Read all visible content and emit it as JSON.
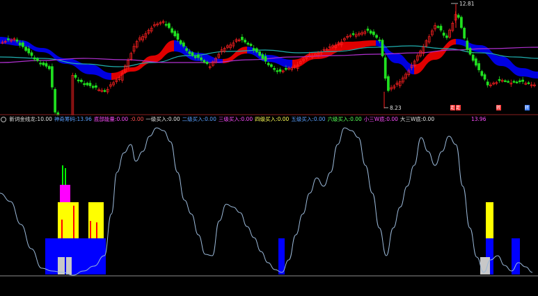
{
  "upper_panel": {
    "high_label": "12.81",
    "low_label": "8.23",
    "right_markers": [
      {
        "text": "走",
        "color": "#ff3b3b"
      },
      {
        "text": "走",
        "color": "#ff3b3b"
      },
      {
        "text": "转",
        "color": "#ff3b3b"
      },
      {
        "text": "转",
        "color": "#3b7bff"
      }
    ]
  },
  "indicator_bar": {
    "prefix_icon": "settings-icon",
    "items": [
      {
        "label": "新词金线龙",
        "value": "10.00",
        "color": "#e0e0e0",
        "sep": ":"
      },
      {
        "label": "神奇筹码",
        "value": "13.96",
        "color": "#5aa0ff",
        "sep": ":"
      },
      {
        "label": "底部能量",
        "value": "0.00",
        "color": "#ff4dff",
        "sep": ":"
      },
      {
        "label": "",
        "value": "0.00",
        "color": "#ff4d4d",
        "sep": ":"
      },
      {
        "label": "一级买入",
        "value": "0.00",
        "color": "#e0e0e0",
        "sep": ":"
      },
      {
        "label": "二级买入",
        "value": "0.00",
        "color": "#5aa0ff",
        "sep": ":"
      },
      {
        "label": "三级买入",
        "value": "0.00",
        "color": "#ff4dff",
        "sep": ":"
      },
      {
        "label": "四级买入",
        "value": "0.00",
        "color": "#ffff55",
        "sep": ":"
      },
      {
        "label": "五级买入",
        "value": "0.00",
        "color": "#5aa0ff",
        "sep": ":"
      },
      {
        "label": "六级买入",
        "value": "0.00",
        "color": "#55ff55",
        "sep": ":"
      },
      {
        "label": "小三W底",
        "value": "0.00",
        "color": "#ff4dff",
        "sep": ":"
      },
      {
        "label": "大三W底",
        "value": "0.00",
        "color": "#e0e0e0",
        "sep": ":"
      }
    ],
    "right_value": "13.96"
  },
  "colors": {
    "background": "#000000",
    "up_candle": "#ff2020",
    "down_candle": "#20e020",
    "ribbon_red": "#e00000",
    "ribbon_blue": "#0000e0",
    "ma_cyan": "#20b0b0",
    "ma_purple": "#b030d0",
    "line_lower": "#9ab8d8",
    "bar_blue": "#0000ff",
    "bar_yellow": "#ffff00",
    "bar_red": "#ff0000",
    "bar_magenta": "#ff00ff",
    "bar_green": "#00ff00",
    "bar_grey": "#c8c8c8",
    "divider": "#8a2020"
  }
}
